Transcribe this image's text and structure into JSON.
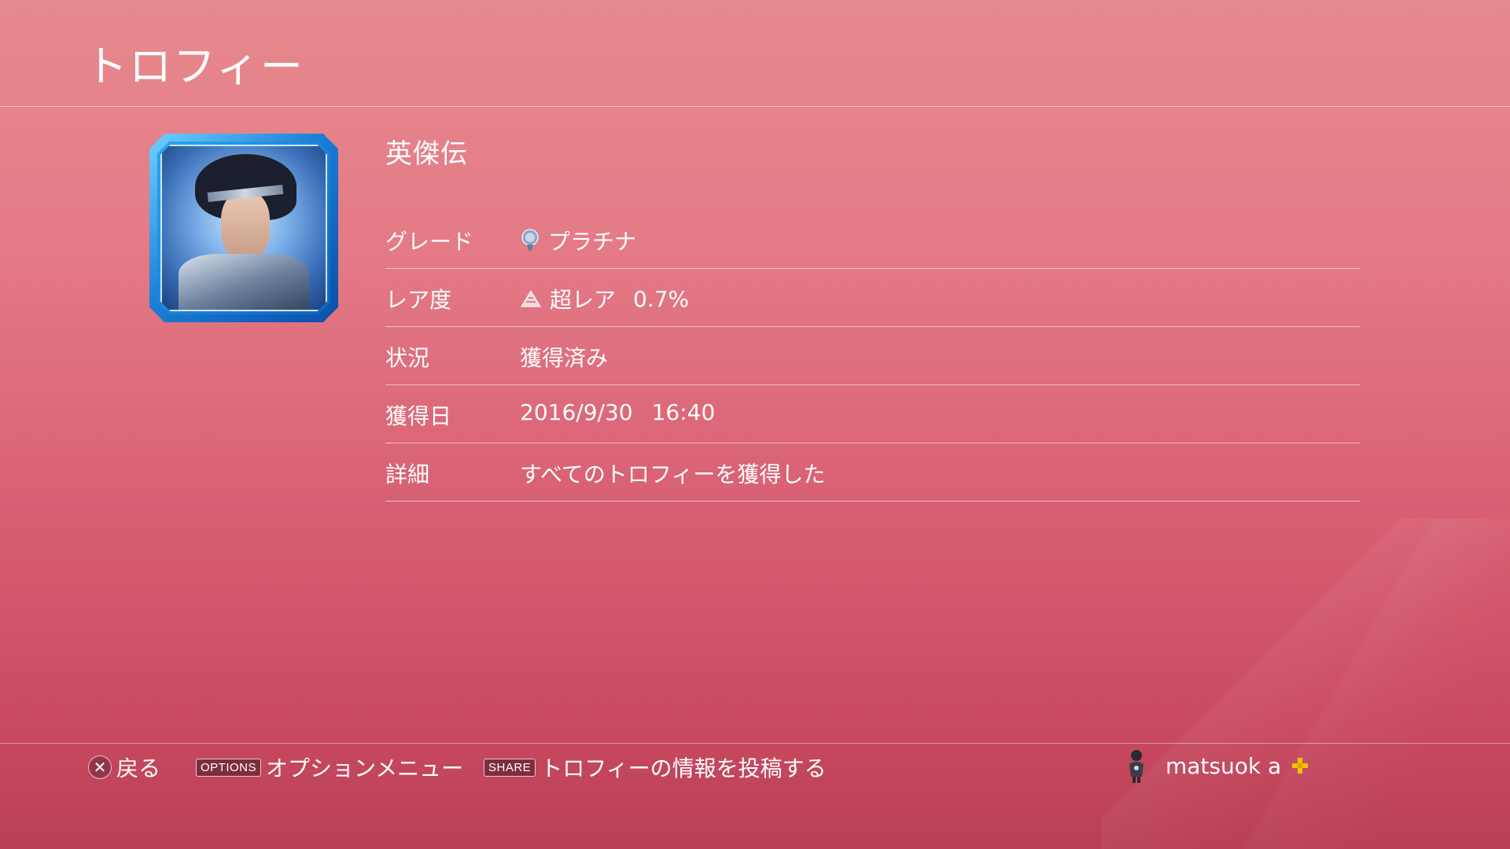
{
  "header": {
    "title": "トロフィー"
  },
  "trophy": {
    "name": "英傑伝",
    "icon": "trophy-portrait-image",
    "frame_color": "#1c7fd8"
  },
  "details": [
    {
      "label": "グレード",
      "value": "プラチナ",
      "icon": "platinum-trophy-icon"
    },
    {
      "label": "レア度",
      "value": "超レア",
      "extra": "0.7%",
      "icon": "ultra-rare-icon"
    },
    {
      "label": "状況",
      "value": "獲得済み"
    },
    {
      "label": "獲得日",
      "value": "2016/9/30",
      "extra": "16:40"
    },
    {
      "label": "詳細",
      "value": "すべてのトロフィーを獲得した"
    }
  ],
  "footer": {
    "back": {
      "button": "✕",
      "label": "戻る"
    },
    "options": {
      "button": "OPTIONS",
      "label": "オプションメニュー"
    },
    "share": {
      "button": "SHARE",
      "label": "トロフィーの情報を投稿する"
    },
    "user": {
      "name": "matsuok a",
      "avatar": "user-avatar",
      "badge": "ps-plus-icon",
      "badge_color": "#f2c200"
    }
  },
  "colors": {
    "background_top": "#e68a8d",
    "background_bottom": "#b83f55",
    "text": "#ffffff"
  }
}
